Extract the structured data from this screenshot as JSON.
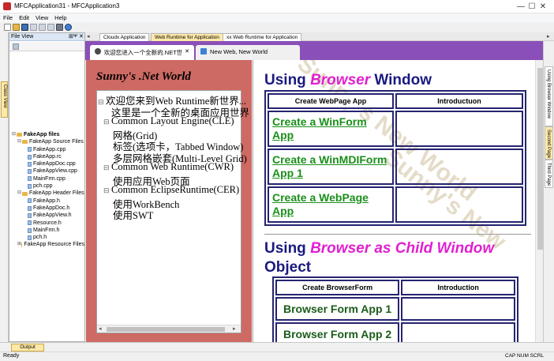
{
  "window": {
    "title": "MFCApplication31 - MFCApplication3",
    "minimize": "—",
    "maximize": "☐",
    "close": "✕"
  },
  "menu": [
    "File",
    "Edit",
    "View",
    "Help"
  ],
  "classview_tab": "Class View",
  "fileview": {
    "title": "File View",
    "pin": "⊞",
    "autohide": "ᴪ",
    "close": "✕",
    "tree": [
      {
        "label": "FakeApp files",
        "level": 0,
        "kind": "folder",
        "exp": "⊟",
        "bold": true
      },
      {
        "label": "FakeApp Source Files",
        "level": 1,
        "kind": "folder",
        "exp": "⊟"
      },
      {
        "label": "FakeApp.cpp",
        "level": 2,
        "kind": "file"
      },
      {
        "label": "FakeApp.rc",
        "level": 2,
        "kind": "file"
      },
      {
        "label": "FakeAppDoc.cpp",
        "level": 2,
        "kind": "file"
      },
      {
        "label": "FakeAppView.cpp",
        "level": 2,
        "kind": "file"
      },
      {
        "label": "MainFrm.cpp",
        "level": 2,
        "kind": "file"
      },
      {
        "label": "pch.cpp",
        "level": 2,
        "kind": "file"
      },
      {
        "label": "FakeApp Header Files",
        "level": 1,
        "kind": "folder",
        "exp": "⊟"
      },
      {
        "label": "FakeApp.h",
        "level": 2,
        "kind": "file"
      },
      {
        "label": "FakeAppDoc.h",
        "level": 2,
        "kind": "file"
      },
      {
        "label": "FakeAppView.h",
        "level": 2,
        "kind": "file"
      },
      {
        "label": "Resource.h",
        "level": 2,
        "kind": "file"
      },
      {
        "label": "MainFrm.h",
        "level": 2,
        "kind": "file"
      },
      {
        "label": "pch.h",
        "level": 2,
        "kind": "file"
      },
      {
        "label": "FakeApp Resource Files",
        "level": 1,
        "kind": "folder",
        "exp": "⊞"
      }
    ]
  },
  "doc_tabs": [
    {
      "label": "Cloudx Application",
      "bg": "#ffffff"
    },
    {
      "label": "Web Runtime for Application",
      "bg": "#ffe9a8"
    },
    {
      "label": "xx Web Runtime for Application",
      "bg": "#ffffff"
    }
  ],
  "inner_tabs": [
    {
      "label": "欢迎您进入一个全新的.NET世界，割",
      "icon_color": "#4a4a4a",
      "close": "✕"
    },
    {
      "label": "New Web, New World",
      "icon_color": "#3f7fd6"
    }
  ],
  "right_tabs": [
    "Using Browser Window",
    "Second Page",
    "Third Page"
  ],
  "left_panel": {
    "title": "Sunny's .Net World",
    "tree": [
      {
        "label": "欢迎您来到Web Runtime新世界...",
        "exp": "⊟",
        "indent": 0
      },
      {
        "label": "这里是一个全新的桌面应用世界",
        "exp": "",
        "indent": 1
      },
      {
        "label": "Common Layout Engine(CLE)",
        "exp": "⊟",
        "indent": 1
      },
      {
        "label": "网格(Grid)",
        "exp": "",
        "indent": 2
      },
      {
        "label": "标签(选项卡，Tabbed Window)",
        "exp": "",
        "indent": 2
      },
      {
        "label": "多层网格嵌套(Multi-Level Grid)",
        "exp": "",
        "indent": 2
      },
      {
        "label": "Common Web Runtime(CWR)",
        "exp": "⊟",
        "indent": 1
      },
      {
        "label": "使用应用Web页面",
        "exp": "",
        "indent": 2
      },
      {
        "label": "Common EclipseRuntime(CER)",
        "exp": "⊟",
        "indent": 1
      },
      {
        "label": "使用WorkBench",
        "exp": "",
        "indent": 2
      },
      {
        "label": "使用SWT",
        "exp": "",
        "indent": 2
      }
    ],
    "scroll_left": "◂",
    "scroll_right": "▸"
  },
  "browser": {
    "h1_pre": "Using ",
    "h1_em": "Browser",
    "h1_post": " Window",
    "table1": {
      "headers": [
        "Create WebPage App",
        "Introductuon"
      ],
      "rows": [
        "Create a WinForm App",
        "Create a WinMDIForm App 1",
        "Create a WebPage App"
      ]
    },
    "h2_pre": "Using ",
    "h2_em": "Browser as Child Window",
    "h2_post": "Object",
    "table2": {
      "headers": [
        "Create BrowserForm",
        "Introduction"
      ],
      "rows": [
        "Browser Form App 1",
        "Browser Form App 2"
      ]
    }
  },
  "output_tab": "Output",
  "status": {
    "left": "Ready",
    "right": "CAP  NUM  SCRL"
  }
}
